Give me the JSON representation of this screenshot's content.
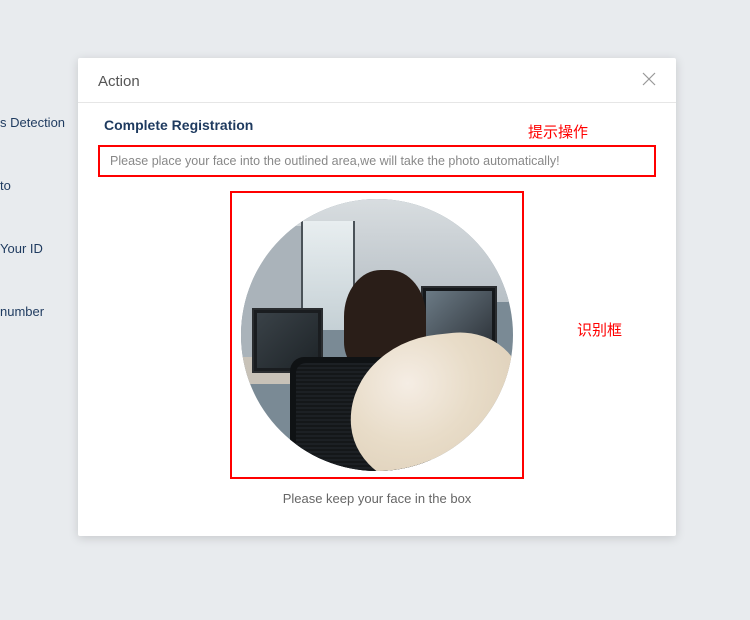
{
  "sidebar": {
    "items": [
      {
        "label": "s Detection"
      },
      {
        "label": "to"
      },
      {
        "label": "Your ID"
      },
      {
        "label": " number"
      }
    ]
  },
  "modal": {
    "title": "Action",
    "reg_title": "Complete Registration",
    "hint_text": "Please place your face into the outlined area,we will take the photo automatically!",
    "bottom_text": "Please keep your face in the box"
  },
  "annotations": {
    "top": "提示操作",
    "side": "识别框"
  }
}
